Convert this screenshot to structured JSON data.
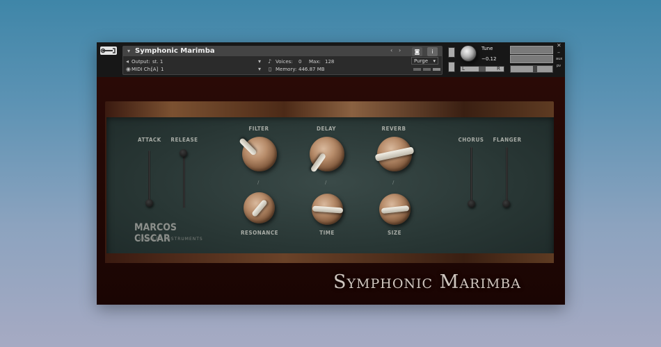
{
  "colors": {
    "background_top": "#3f86a8",
    "background_bottom": "#a6aac3",
    "plugin_bg": "#1e0705",
    "knob_body": "#b78c6a",
    "panel": "#2e3e3c"
  },
  "header": {
    "instrument_name": "Symphonic Marimba",
    "output_label": "Output:",
    "output_value": "st. 1",
    "voices_label": "Voices:",
    "voices_value": "0",
    "max_label": "Max:",
    "max_value": "128",
    "midi_label": "MIDI Ch:",
    "midi_port": "[A]",
    "midi_value": "1",
    "memory_label": "Memory:",
    "memory_value": "446.87 MB",
    "purge_label": "Purge",
    "tune_label": "Tune",
    "tune_value": "−0.12",
    "pan_left": "L",
    "pan_right": "R",
    "aux_label": "aux",
    "pv_label": "pv"
  },
  "controls": {
    "attack_label": "ATTACK",
    "release_label": "RELEASE",
    "filter_label": "FILTER",
    "delay_label": "DELAY",
    "reverb_label": "REVERB",
    "resonance_label": "RESONANCE",
    "time_label": "TIME",
    "size_label": "SIZE",
    "chorus_label": "CHORUS",
    "flanger_label": "FLANGER"
  },
  "branding": {
    "maker": "MARCOS CISCAR",
    "maker_sub": "SAMPLED INSTRUMENTS",
    "title": "Symphonic Marimba"
  }
}
